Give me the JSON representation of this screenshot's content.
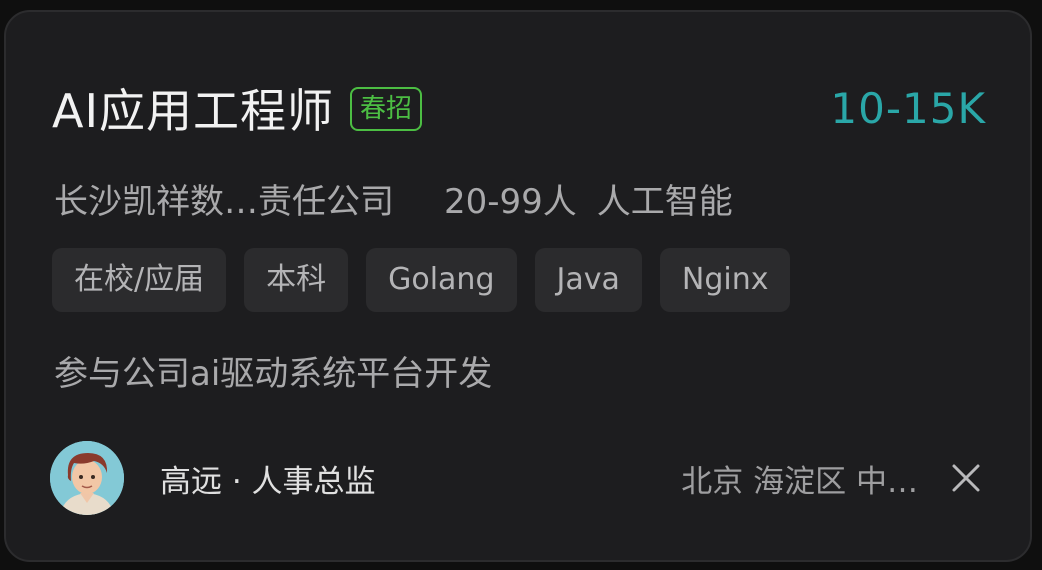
{
  "job": {
    "title": "AI应用工程师",
    "badge": "春招",
    "salary": "10-15K"
  },
  "company": {
    "name": "长沙凯祥数…责任公司",
    "size": "20-99人",
    "industry": "人工智能"
  },
  "tags": [
    "在校/应届",
    "本科",
    "Golang",
    "Java",
    "Nginx"
  ],
  "description": "参与公司ai驱动系统平台开发",
  "recruiter": {
    "name_title": "高远 · 人事总监",
    "avatar_icon": "cartoon-person-avatar"
  },
  "location": "北京  海淀区  中…",
  "colors": {
    "card_bg": "#1d1d1f",
    "salary": "#2aa7a8",
    "badge": "#4cbe43",
    "tag_bg": "#2b2b2d"
  },
  "icons": {
    "close": "close-icon"
  }
}
